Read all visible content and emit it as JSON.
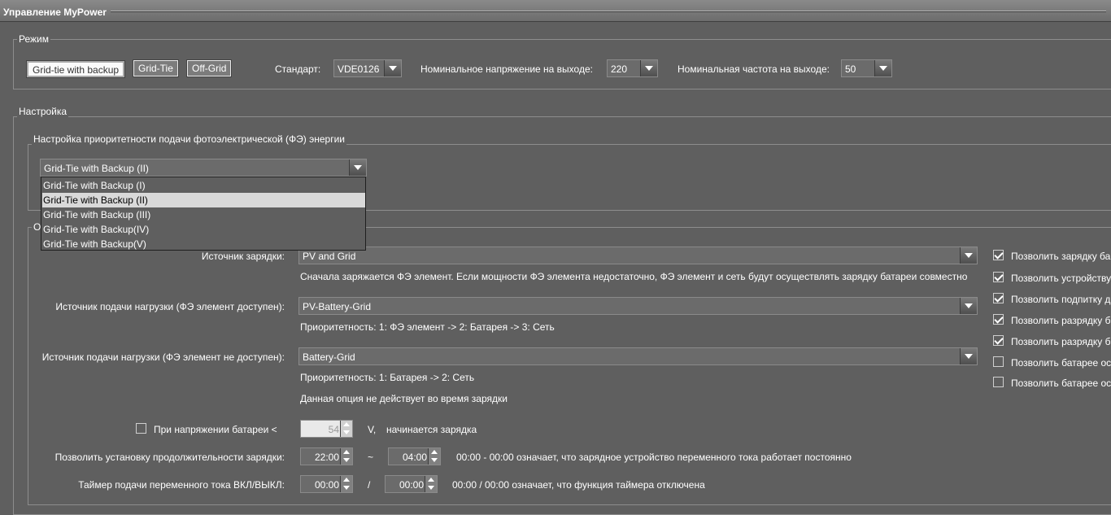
{
  "window": {
    "title": "Управление MyPower"
  },
  "mode": {
    "legend": "Режим",
    "buttons": [
      "Grid-tie with backup",
      "Grid-Tie",
      "Off-Grid"
    ],
    "standard_label": "Стандарт:",
    "standard_value": "VDE0126",
    "voltage_label": "Номинальное напряжение на выходе:",
    "voltage_value": "220",
    "frequency_label": "Номинальная частота на выходе:",
    "frequency_value": "50"
  },
  "settings": {
    "legend": "Настройка",
    "priority_legend": "Настройка приоритетности подачи фотоэлектрической (ФЭ) энергии",
    "priority_selected": "Grid-Tie with Backup (II)",
    "priority_options": [
      "Grid-Tie with Backup (I)",
      "Grid-Tie with Backup (II)",
      "Grid-Tie with Backup (III)",
      "Grid-Tie with Backup(IV)",
      "Grid-Tie with Backup(V)"
    ],
    "other_legend_fragment": "О"
  },
  "charge": {
    "source_label": "Источник зарядки:",
    "source_value": "PV and Grid",
    "source_desc": "Сначала заряжается ФЭ элемент. Если мощности ФЭ элемента недостаточно, ФЭ элемент и сеть будут осуществлять зарядку батареи совместно",
    "load_pv_label": "Источник подачи нагрузки (ФЭ элемент доступен):",
    "load_pv_value": "PV-Battery-Grid",
    "load_pv_desc": "Приоритетность: 1: ФЭ элемент -> 2: Батарея -> 3: Сеть",
    "load_nopv_label": "Источник подачи нагрузки (ФЭ элемент не доступен):",
    "load_nopv_value": "Battery-Grid",
    "load_nopv_desc": "Приоритетность: 1: Батарея -> 2: Сеть",
    "load_nopv_note": "Данная опция не действует во время зарядки",
    "battery_voltage_label": "При напряжении батареи <",
    "battery_voltage_value": "54",
    "battery_voltage_unit": "V,",
    "battery_voltage_suffix": "начинается зарядка",
    "duration_label": "Позволить установку продолжительности зарядки:",
    "duration_from": "22:00",
    "duration_sep": "~",
    "duration_to": "04:00",
    "duration_note": "00:00 - 00:00 означает, что зарядное устройство переменного тока работает постоянно",
    "timer_label": "Таймер подачи переменного тока ВКЛ/ВЫКЛ:",
    "timer_from": "00:00",
    "timer_sep": "/",
    "timer_to": "00:00",
    "timer_note": "00:00 / 00:00 означает, что функция таймера отключена"
  },
  "options": [
    {
      "label": "Позволить зарядку ба",
      "checked": true
    },
    {
      "label": "Позволить устройству",
      "checked": true
    },
    {
      "label": "Позволить подпитку д",
      "checked": true
    },
    {
      "label": "Позволить разрядку б",
      "checked": true
    },
    {
      "label": "Позволить разрядку б",
      "checked": true
    },
    {
      "label": "Позволить батарее ос",
      "checked": false
    },
    {
      "label": "Позволить батарее ос",
      "checked": false
    }
  ]
}
